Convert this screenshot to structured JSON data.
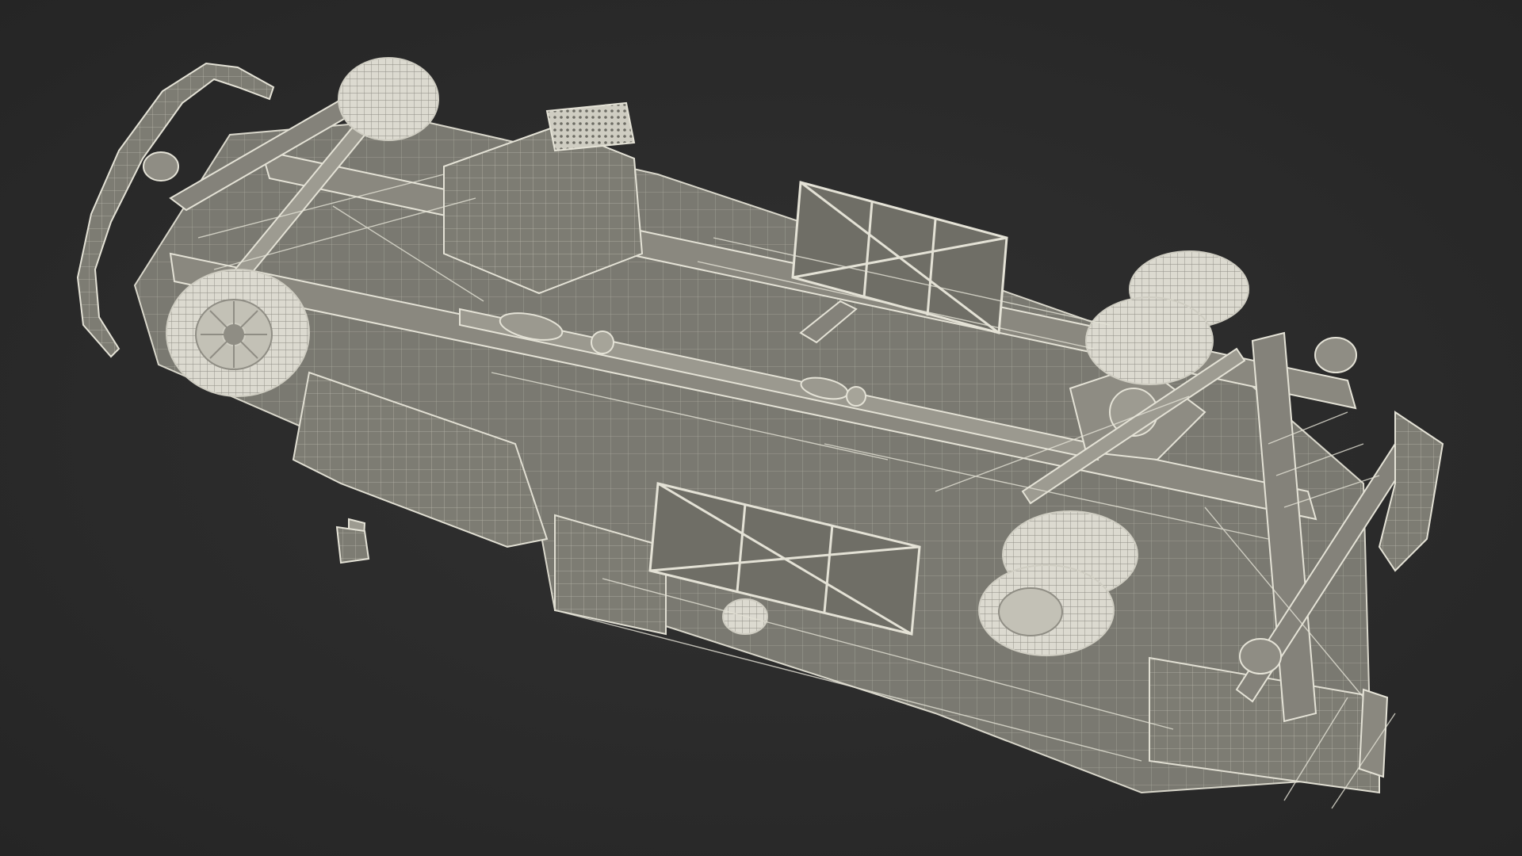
{
  "scene": {
    "subject": "wireframe-truck-chassis-underside",
    "colors": {
      "background": "#2b2b2b",
      "body_fill": "#7b7a72",
      "body_dark": "#5e5d57",
      "wire": "#e4e2d6",
      "wire_soft": "#c9c7bb",
      "tire_fill": "#d8d6cc",
      "rim_fill": "#bdbbb1",
      "shadow": "#4a4944"
    }
  }
}
